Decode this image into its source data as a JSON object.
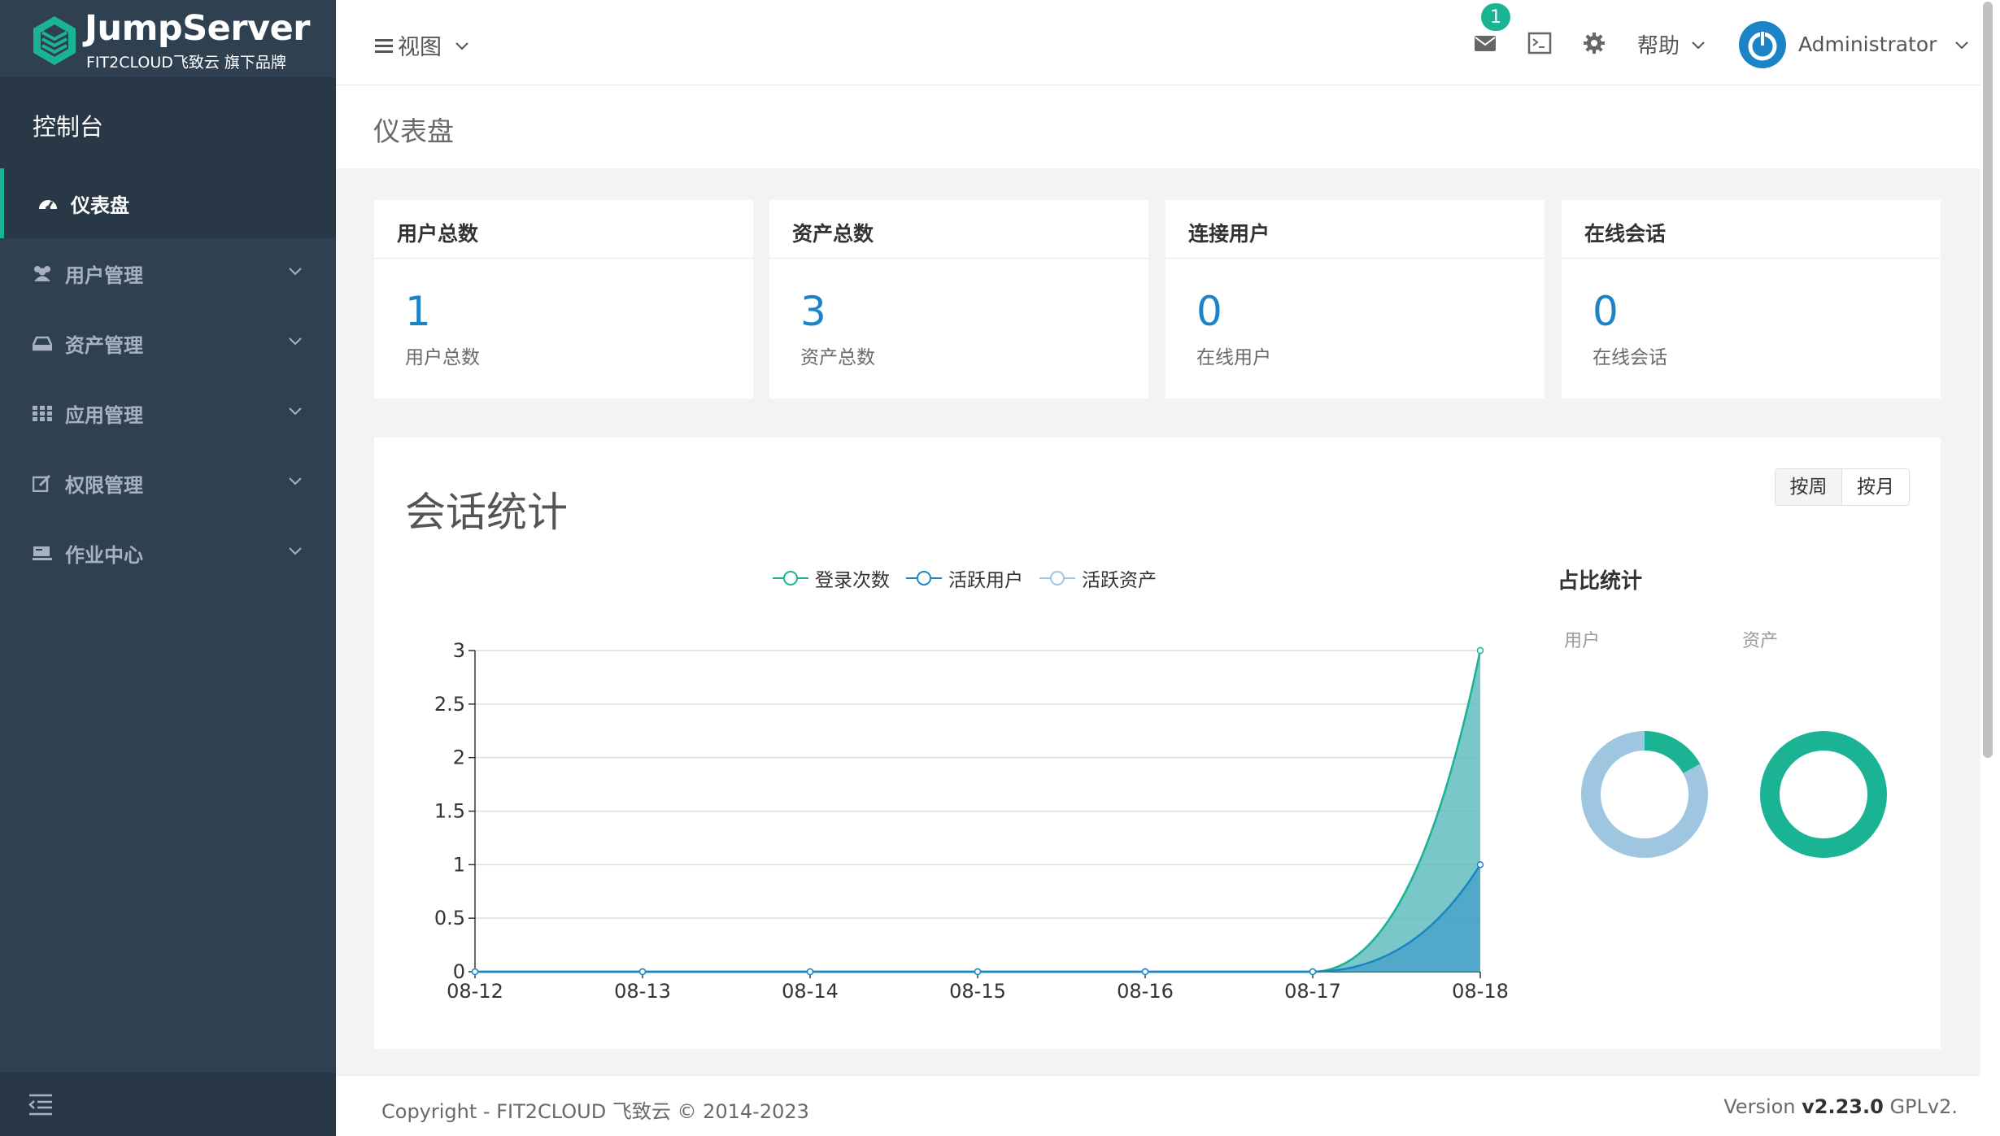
{
  "brand": {
    "title": "JumpServer",
    "subtitle": "FIT2CLOUD飞致云 旗下品牌"
  },
  "sidebar": {
    "console_label": "控制台",
    "items": [
      {
        "label": "仪表盘",
        "icon": "dashboard-icon",
        "active": true
      },
      {
        "label": "用户管理",
        "icon": "users-icon"
      },
      {
        "label": "资产管理",
        "icon": "assets-icon"
      },
      {
        "label": "应用管理",
        "icon": "apps-icon"
      },
      {
        "label": "权限管理",
        "icon": "perms-icon"
      },
      {
        "label": "作业中心",
        "icon": "jobs-icon"
      }
    ]
  },
  "header": {
    "view_label": "视图",
    "badge_count": "1",
    "help_label": "帮助",
    "user_name": "Administrator"
  },
  "page": {
    "title": "仪表盘"
  },
  "cards": [
    {
      "title": "用户总数",
      "value": "1",
      "sub": "用户总数"
    },
    {
      "title": "资产总数",
      "value": "3",
      "sub": "资产总数"
    },
    {
      "title": "连接用户",
      "value": "0",
      "sub": "在线用户"
    },
    {
      "title": "在线会话",
      "value": "0",
      "sub": "在线会话"
    }
  ],
  "stats": {
    "title": "会话统计",
    "toggle": [
      "按周",
      "按月"
    ],
    "legend": [
      "登录次数",
      "活跃用户",
      "活跃资产"
    ],
    "ratio_title": "占比统计",
    "ratio_labels": [
      "用户",
      "资产"
    ]
  },
  "chart_data": [
    {
      "type": "area",
      "x": [
        "08-12",
        "08-13",
        "08-14",
        "08-15",
        "08-16",
        "08-17",
        "08-18"
      ],
      "ylim": [
        0,
        3
      ],
      "yticks": [
        "0",
        "0.5",
        "1",
        "1.5",
        "2",
        "2.5",
        "3"
      ],
      "grid": true,
      "legend_position": "top",
      "series": [
        {
          "name": "登录次数",
          "values": [
            0,
            0,
            0,
            0,
            0,
            0,
            3
          ],
          "color": "#1ab394"
        },
        {
          "name": "活跃用户",
          "values": [
            0,
            0,
            0,
            0,
            0,
            0,
            1
          ],
          "color": "#1c84c6"
        },
        {
          "name": "活跃资产",
          "values": [
            0,
            0,
            0,
            0,
            0,
            0,
            3
          ],
          "color": "#9ec6e0"
        }
      ]
    },
    {
      "type": "pie",
      "title": "用户",
      "values": [
        0.17,
        0.83
      ],
      "colors": [
        "#1ab394",
        "#9ec6e0"
      ]
    },
    {
      "type": "pie",
      "title": "资产",
      "values": [
        1
      ],
      "colors": [
        "#1ab394"
      ]
    }
  ],
  "footer": {
    "copyright": "Copyright - FIT2CLOUD 飞致云 © 2014-2023",
    "version_prefix": "Version ",
    "version_num": "v2.23.0",
    "version_suffix": " GPLv2."
  },
  "colors": {
    "sidebar": "#2f4050",
    "accent": "#1ab394",
    "primary": "#1c84c6"
  }
}
